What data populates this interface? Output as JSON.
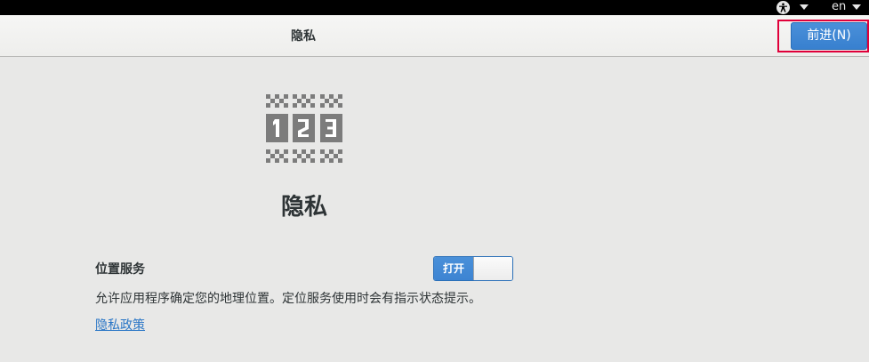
{
  "topbar": {
    "accessibility_icon": "accessibility-icon",
    "language": "en"
  },
  "header": {
    "title": "隐私",
    "next_button": "前进(N)"
  },
  "main": {
    "icon": "privacy-123-icon",
    "title": "隐私",
    "location": {
      "label": "位置服务",
      "toggle_label": "打开",
      "toggle_state": "on",
      "description": "允许应用程序确定您的地理位置。定位服务使用时会有指示状态提示。"
    },
    "policy_link": "隐私政策"
  },
  "colors": {
    "accent": "#4a90d9",
    "topbar": "#000000",
    "background": "#e8e8e7",
    "link": "#2a76c6",
    "highlight_outline": "#e0003a"
  }
}
